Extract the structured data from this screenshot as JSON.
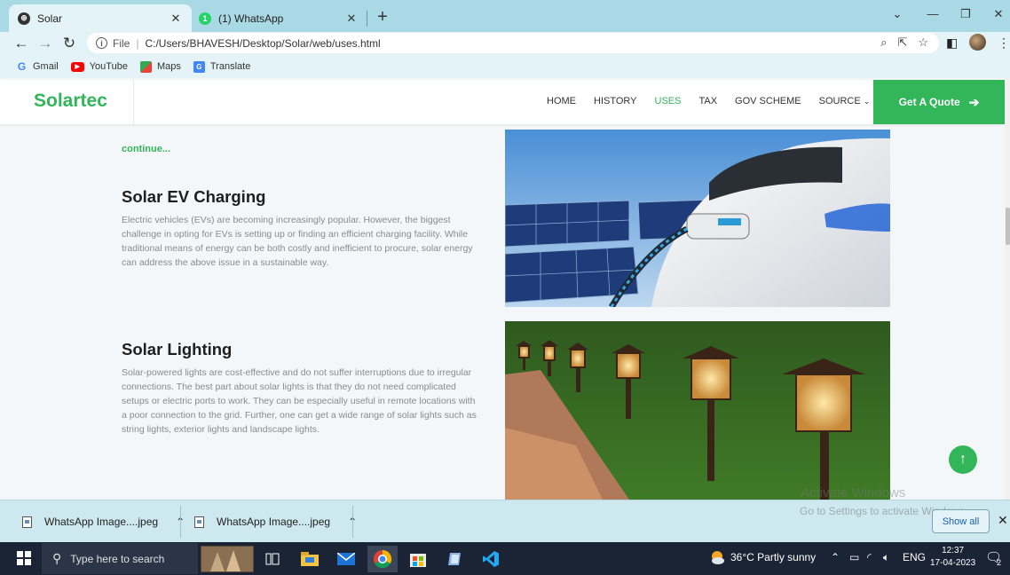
{
  "browser": {
    "tabs": [
      {
        "title": "Solar",
        "active": true
      },
      {
        "title": "(1) WhatsApp",
        "active": false,
        "badge": "1"
      }
    ],
    "url": {
      "scheme": "File",
      "path": "C:/Users/BHAVESH/Desktop/Solar/web/uses.html"
    },
    "bookmarks": [
      "Gmail",
      "YouTube",
      "Maps",
      "Translate"
    ]
  },
  "site": {
    "logo": "Solartec",
    "nav": [
      "HOME",
      "HISTORY",
      "USES",
      "TAX",
      "GOV SCHEME",
      "SOURCE"
    ],
    "active_nav": "USES",
    "cta": "Get A Quote",
    "accent": "#33b55a",
    "continue_link": "continue...",
    "sections": [
      {
        "title": "Solar EV Charging",
        "text": "Electric vehicles (EVs) are becoming increasingly popular. However, the biggest challenge in opting for EVs is setting up or finding an efficient charging facility. While traditional means of energy can be both costly and inefficient to procure, solar energy can address the above issue in a sustainable way."
      },
      {
        "title": "Solar Lighting",
        "text": "Solar-powered lights are cost-effective and do not suffer interruptions due to irregular connections. The best part about solar lights is that they do not need complicated setups or electric ports to work. They can be especially useful in remote locations with a poor connection to the grid. Further, one can get a wide range of solar lights such as string lights, exterior lights and landscape lights."
      }
    ]
  },
  "watermark": {
    "line1": "Activate Windows",
    "line2": "Go to Settings to activate Windows."
  },
  "downloads": {
    "items": [
      "WhatsApp Image....jpeg",
      "WhatsApp Image....jpeg"
    ],
    "show_all": "Show all"
  },
  "taskbar": {
    "search_placeholder": "Type here to search",
    "weather": "36°C  Partly sunny",
    "language": "ENG",
    "time": "12:37",
    "date": "17-04-2023",
    "notifications": "2"
  }
}
